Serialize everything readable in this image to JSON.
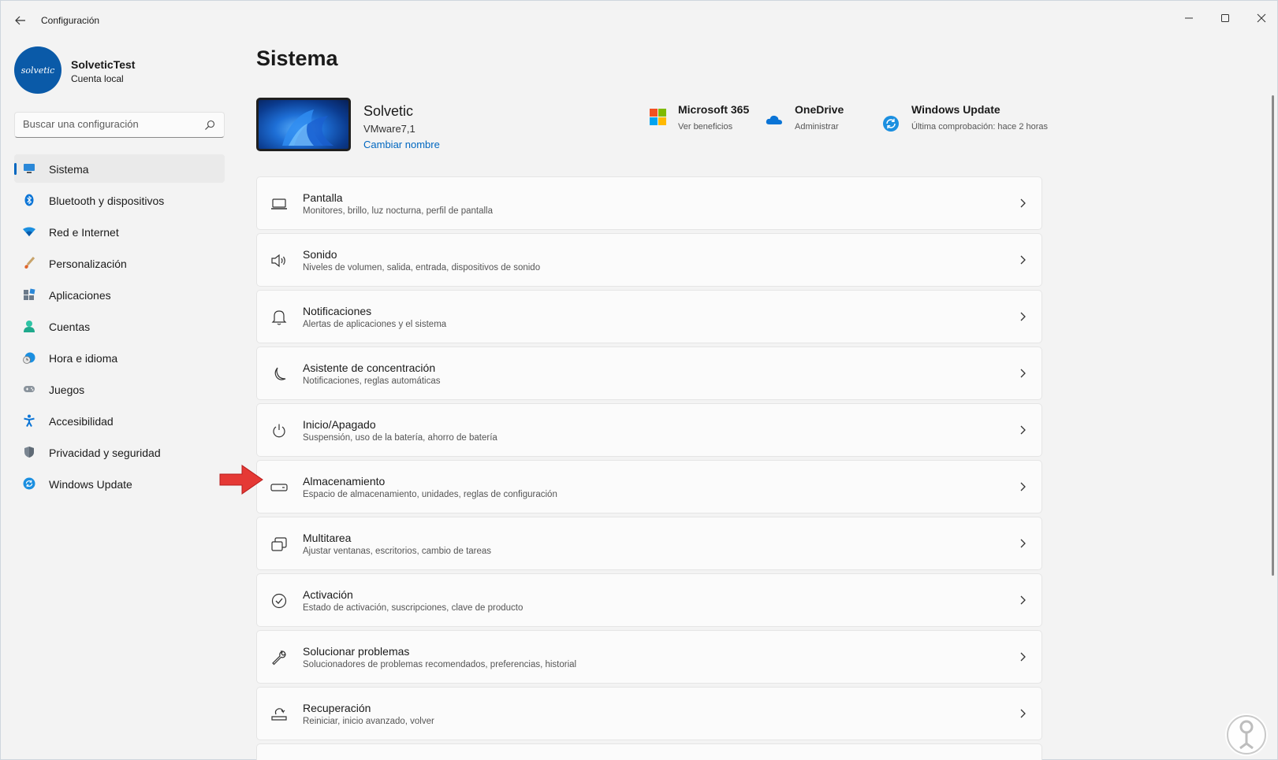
{
  "window": {
    "title": "Configuración"
  },
  "profile": {
    "name": "SolveticTest",
    "account_type": "Cuenta local",
    "avatar_text": "solvetic"
  },
  "search": {
    "placeholder": "Buscar una configuración"
  },
  "nav": {
    "items": [
      {
        "label": "Sistema",
        "icon": "monitor-icon",
        "active": true
      },
      {
        "label": "Bluetooth y dispositivos",
        "icon": "bluetooth-icon"
      },
      {
        "label": "Red e Internet",
        "icon": "wifi-icon"
      },
      {
        "label": "Personalización",
        "icon": "brush-icon"
      },
      {
        "label": "Aplicaciones",
        "icon": "apps-icon"
      },
      {
        "label": "Cuentas",
        "icon": "person-icon"
      },
      {
        "label": "Hora e idioma",
        "icon": "clock-globe-icon"
      },
      {
        "label": "Juegos",
        "icon": "gamepad-icon"
      },
      {
        "label": "Accesibilidad",
        "icon": "accessibility-icon"
      },
      {
        "label": "Privacidad y seguridad",
        "icon": "shield-icon"
      },
      {
        "label": "Windows Update",
        "icon": "update-icon"
      }
    ]
  },
  "main": {
    "title": "Sistema",
    "device": {
      "name": "Solvetic",
      "model": "VMware7,1",
      "rename_link": "Cambiar nombre"
    },
    "info": [
      {
        "title": "Microsoft 365",
        "sub": "Ver beneficios",
        "icon": "microsoft-logo-icon"
      },
      {
        "title": "OneDrive",
        "sub": "Administrar",
        "icon": "onedrive-cloud-icon"
      },
      {
        "title": "Windows Update",
        "sub": "Última comprobación: hace 2 horas",
        "icon": "update-icon"
      }
    ],
    "settings": [
      {
        "title": "Pantalla",
        "desc": "Monitores, brillo, luz nocturna, perfil de pantalla",
        "icon": "laptop-icon"
      },
      {
        "title": "Sonido",
        "desc": "Niveles de volumen, salida, entrada, dispositivos de sonido",
        "icon": "speaker-icon"
      },
      {
        "title": "Notificaciones",
        "desc": "Alertas de aplicaciones y el sistema",
        "icon": "bell-icon"
      },
      {
        "title": "Asistente de concentración",
        "desc": "Notificaciones, reglas automáticas",
        "icon": "moon-icon"
      },
      {
        "title": "Inicio/Apagado",
        "desc": "Suspensión, uso de la batería, ahorro de batería",
        "icon": "power-icon"
      },
      {
        "title": "Almacenamiento",
        "desc": "Espacio de almacenamiento, unidades, reglas de configuración",
        "icon": "storage-drive-icon"
      },
      {
        "title": "Multitarea",
        "desc": "Ajustar ventanas, escritorios, cambio de tareas",
        "icon": "multitask-icon"
      },
      {
        "title": "Activación",
        "desc": "Estado de activación, suscripciones, clave de producto",
        "icon": "check-circle-icon"
      },
      {
        "title": "Solucionar problemas",
        "desc": "Solucionadores de problemas recomendados, preferencias, historial",
        "icon": "wrench-icon"
      },
      {
        "title": "Recuperación",
        "desc": "Reiniciar, inicio avanzado, volver",
        "icon": "recovery-icon"
      }
    ]
  },
  "colors": {
    "accent": "#0067c0",
    "arrow": "#e53935",
    "background": "#f3f3f3",
    "card": "#fbfbfb"
  }
}
